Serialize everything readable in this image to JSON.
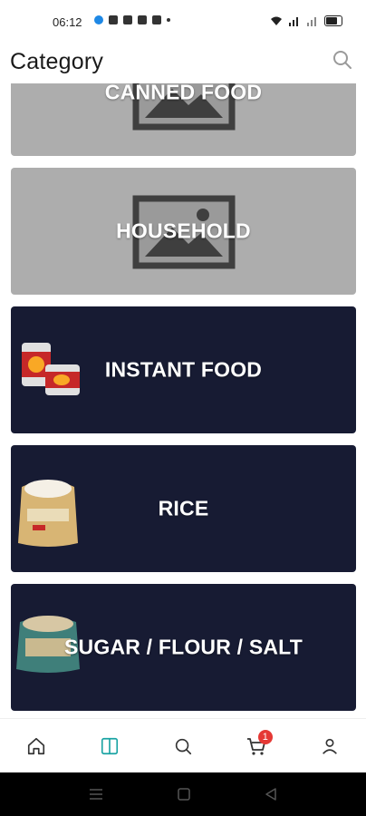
{
  "status_bar": {
    "time": "06:12"
  },
  "header": {
    "title": "Category"
  },
  "categories": [
    {
      "label": "CANNED FOOD",
      "image": "placeholder-image-icon"
    },
    {
      "label": "HOUSEHOLD",
      "image": "placeholder-image-icon"
    },
    {
      "label": "INSTANT FOOD",
      "image": "canned-goods-thumbnail"
    },
    {
      "label": "RICE",
      "image": "rice-sack-thumbnail"
    },
    {
      "label": "SUGAR / FLOUR / SALT",
      "image": "flour-sack-thumbnail"
    }
  ],
  "bottom_nav": {
    "items": [
      {
        "icon": "home-icon"
      },
      {
        "icon": "categories-icon",
        "active": true
      },
      {
        "icon": "search-icon"
      },
      {
        "icon": "cart-icon",
        "badge": "1"
      },
      {
        "icon": "profile-icon"
      }
    ]
  },
  "colors": {
    "accent": "#1aa3a3",
    "card_dark": "#171b33",
    "card_gray": "#adadad",
    "badge": "#e53935"
  }
}
